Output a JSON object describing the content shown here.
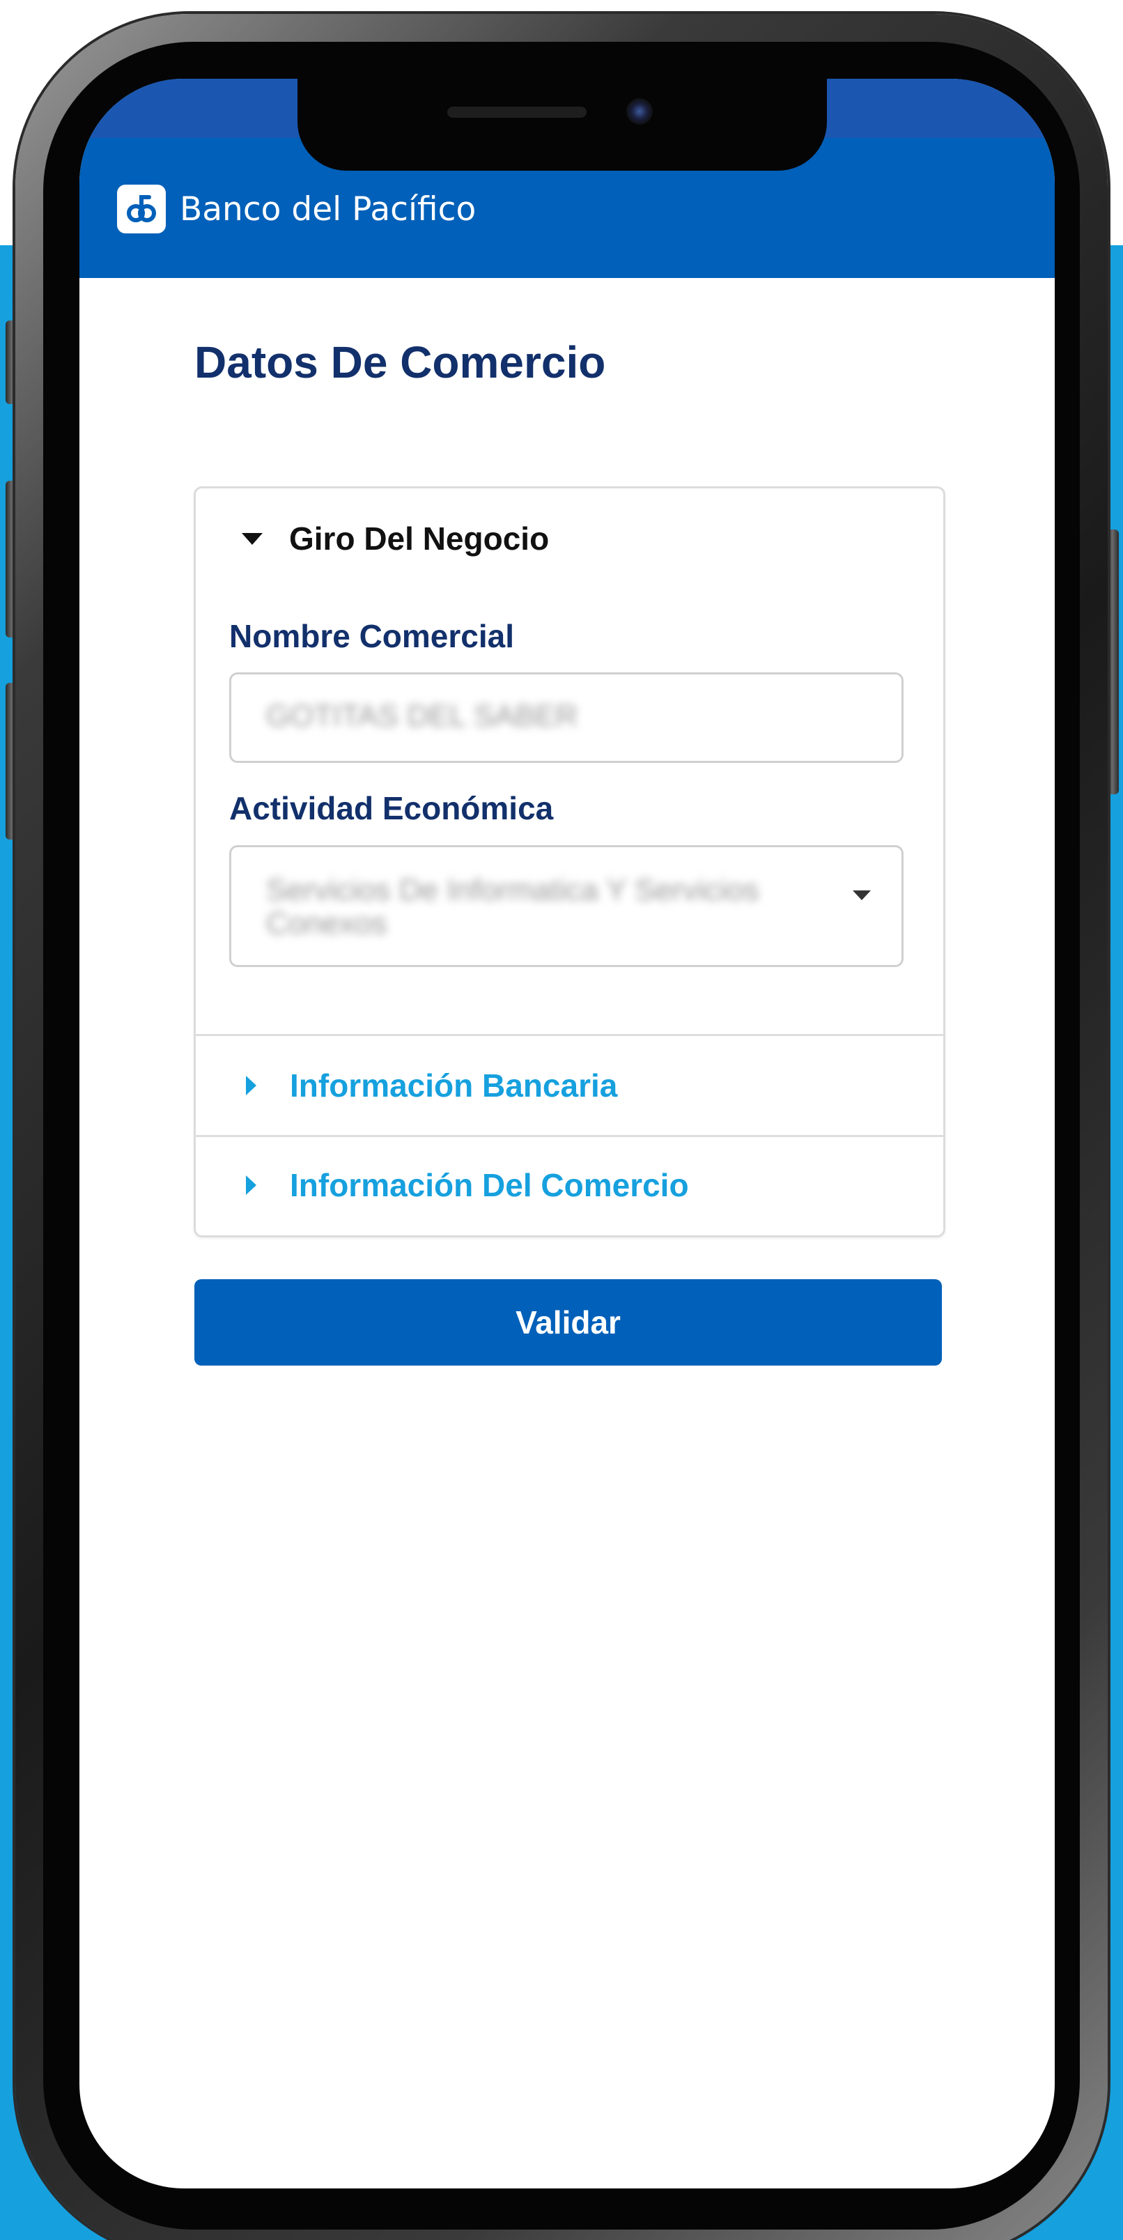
{
  "app": {
    "brand_name": "Banco del Pacífico",
    "brand_color": "#0160b9",
    "accent_color": "#16a0de",
    "title_color": "#12306b"
  },
  "page": {
    "title": "Datos De Comercio"
  },
  "accordion": {
    "giro": {
      "label": "Giro Del Negocio",
      "expanded": true,
      "icon": "caret-down-icon",
      "nombre_comercial": {
        "label": "Nombre Comercial",
        "value": "GOTITAS DEL SABER"
      },
      "actividad_economica": {
        "label": "Actividad Económica",
        "value": "Servicios De Informatica Y Servicios Conexos"
      }
    },
    "bancaria": {
      "label": "Información Bancaria",
      "expanded": false,
      "icon": "caret-right-icon"
    },
    "comercio": {
      "label": "Información Del Comercio",
      "expanded": false,
      "icon": "caret-right-icon"
    }
  },
  "actions": {
    "validate_label": "Validar"
  }
}
